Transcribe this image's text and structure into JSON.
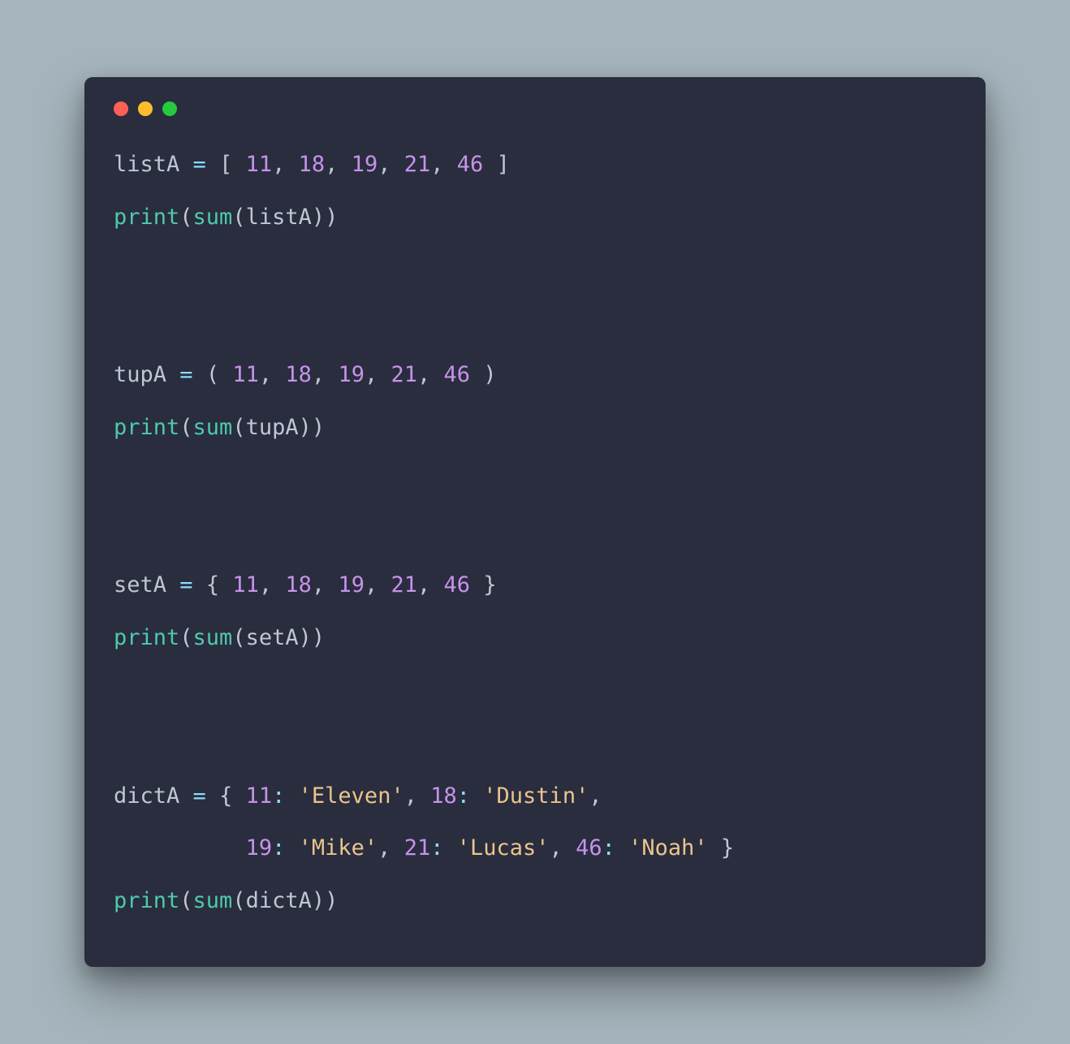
{
  "window": {
    "controls": {
      "close": "close",
      "minimize": "minimize",
      "zoom": "zoom"
    },
    "colors": {
      "bg": "#292d3e",
      "page_bg": "#a6b5bd"
    }
  },
  "syntax_colors": {
    "identifier": "#bfc7d5",
    "operator": "#89ddff",
    "number": "#c792ea",
    "function": "#82aaff",
    "builtin": "#4ec9b0",
    "string": "#ecc48d"
  },
  "code": {
    "vars": {
      "list": "listA",
      "tuple": "tupA",
      "set": "setA",
      "dict": "dictA"
    },
    "fns": {
      "print": "print",
      "sum": "sum"
    },
    "ops": {
      "assign": "="
    },
    "brackets": {
      "lsq": "[",
      "rsq": "]",
      "lpar": "(",
      "rpar": ")",
      "lcur": "{",
      "rcur": "}"
    },
    "punct": {
      "comma": ",",
      "colon": ":"
    },
    "nums": {
      "n11": "11",
      "n18": "18",
      "n19": "19",
      "n21": "21",
      "n46": "46"
    },
    "strings": {
      "eleven": "'Eleven'",
      "dustin": "'Dustin'",
      "mike": "'Mike'",
      "lucas": "'Lucas'",
      "noah": "'Noah'"
    }
  }
}
